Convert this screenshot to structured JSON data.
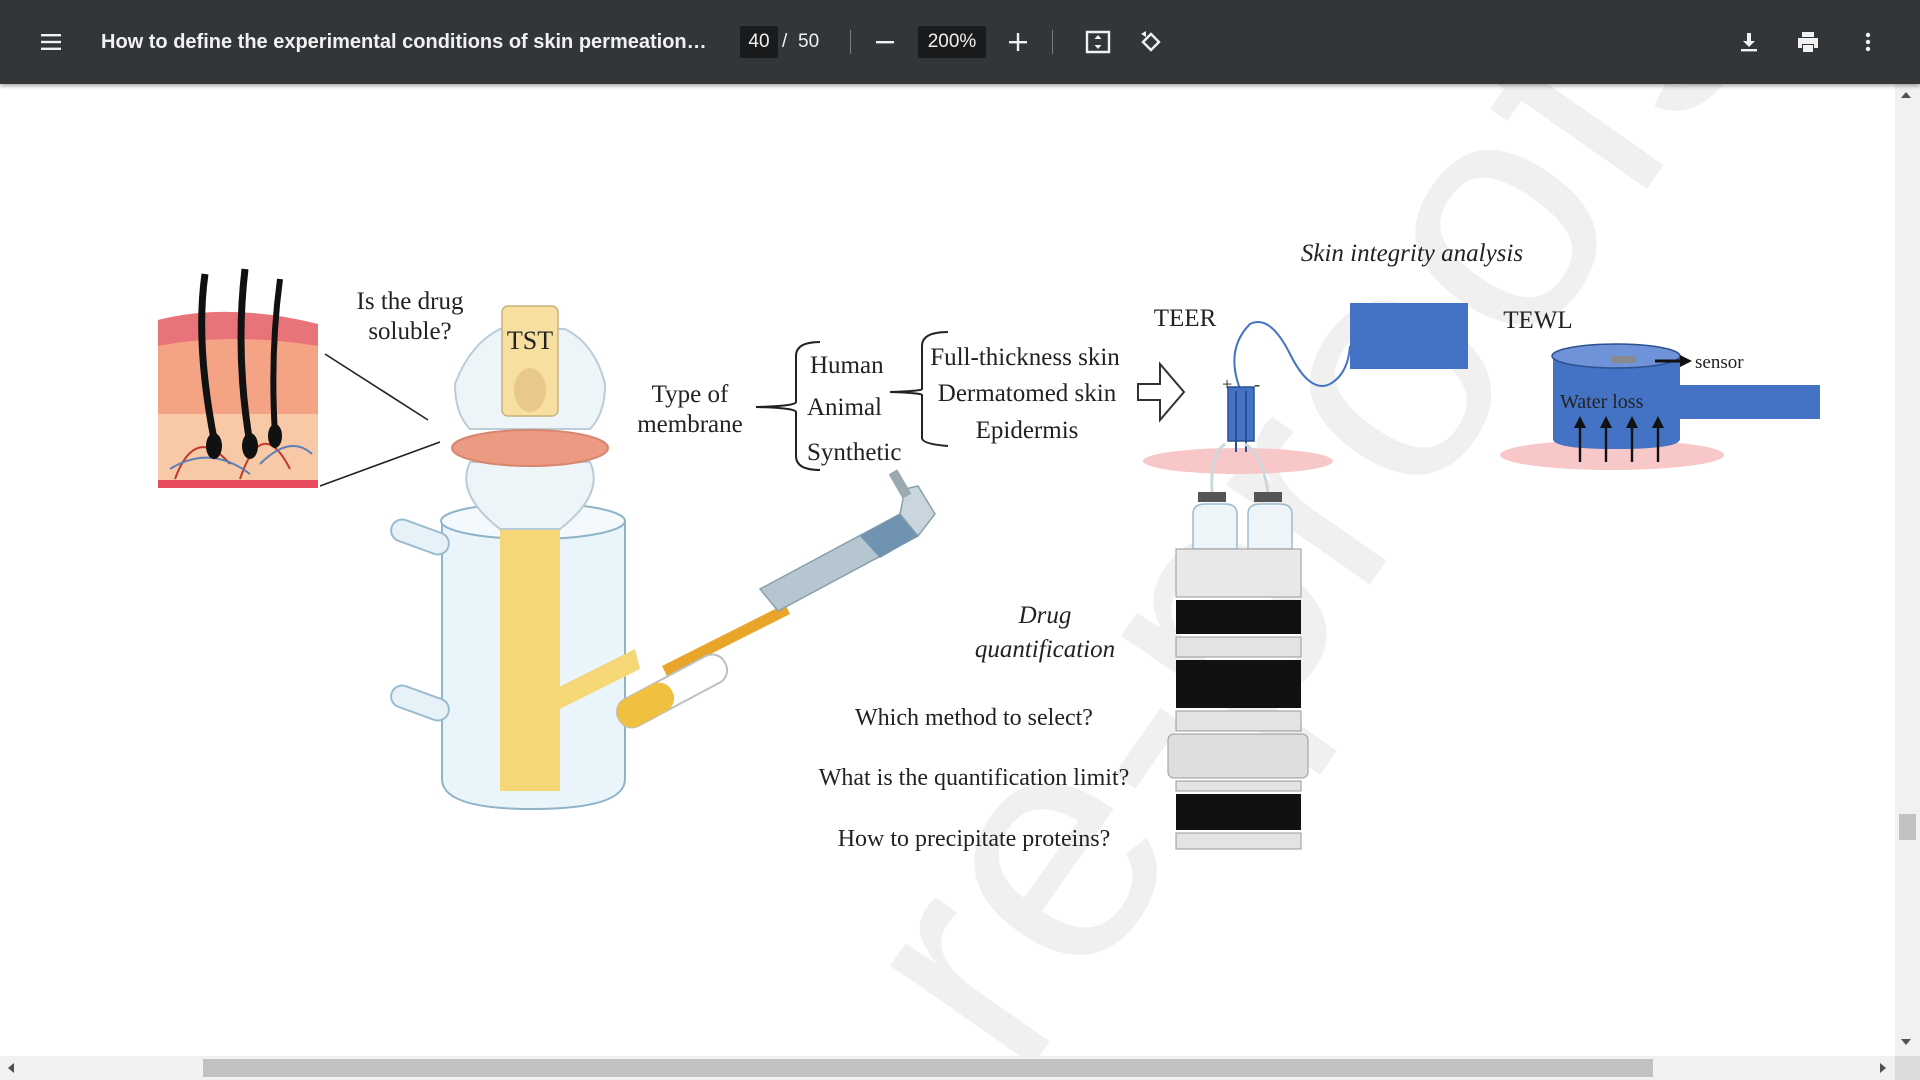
{
  "toolbar": {
    "title": "How to define the experimental conditions of skin permeation a...",
    "current_page": "40",
    "page_separator": "/",
    "total_pages": "50",
    "zoom": "200%"
  },
  "icons": {
    "menu": "menu-icon",
    "zoom_out": "minus-icon",
    "zoom_in": "plus-icon",
    "fit": "fit-to-page-icon",
    "rotate": "rotate-icon",
    "download": "download-icon",
    "print": "print-icon",
    "more": "more-vert-icon"
  },
  "figure": {
    "question_soluble_line1": "Is the drug",
    "question_soluble_line2": "soluble?",
    "tst": "TST",
    "type_line1": "Type of",
    "type_line2": "membrane",
    "membrane_types": [
      "Human",
      "Animal",
      "Synthetic"
    ],
    "skin_types": [
      "Full-thickness skin",
      "Dermatomed skin",
      "Epidermis"
    ],
    "integrity_title": "Skin integrity analysis",
    "teer": "TEER",
    "tewl": "TEWL",
    "sensor": "sensor",
    "water_loss": "Water loss",
    "plus_sign": "+",
    "minus_sign": "-",
    "quant_line1": "Drug",
    "quant_line2": "quantification",
    "questions": [
      "Which method to select?",
      "What is the quantification limit?",
      "How to precipitate proteins?"
    ],
    "watermark": "re-proofs"
  },
  "colors": {
    "toolbar": "#323639",
    "blue_box": "#4472c4",
    "pink_base": "#f8c8c8",
    "yellow": "#f5d778"
  }
}
